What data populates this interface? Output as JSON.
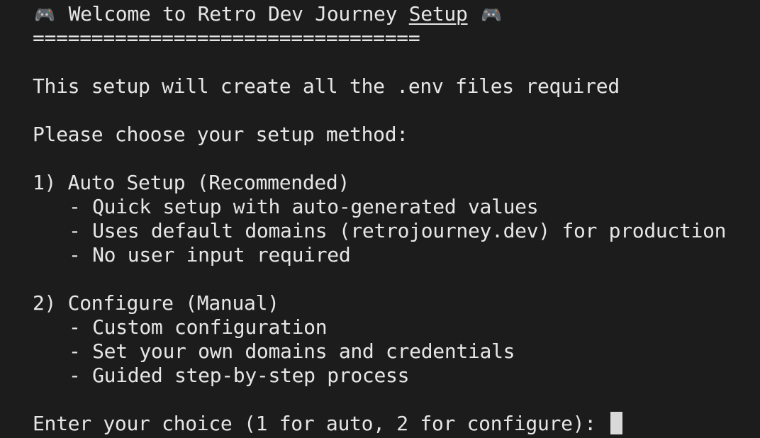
{
  "title": {
    "icon_left": "gamepad-icon",
    "prefix": "Welcome to Retro Dev Journey ",
    "underlined": "Setup",
    "icon_right": "gamepad-icon",
    "separator": "================================="
  },
  "intro": "This setup will create all the .env files required",
  "prompt_method": "Please choose your setup method:",
  "options": [
    {
      "heading": "1) Auto Setup (Recommended)",
      "details": [
        "- Quick setup with auto-generated values",
        "- Uses default domains (retrojourney.dev) for production",
        "- No user input required"
      ]
    },
    {
      "heading": "2) Configure (Manual)",
      "details": [
        "- Custom configuration",
        "- Set your own domains and credentials",
        "- Guided step-by-step process"
      ]
    }
  ],
  "input_prompt": "Enter your choice (1 for auto, 2 for configure): "
}
